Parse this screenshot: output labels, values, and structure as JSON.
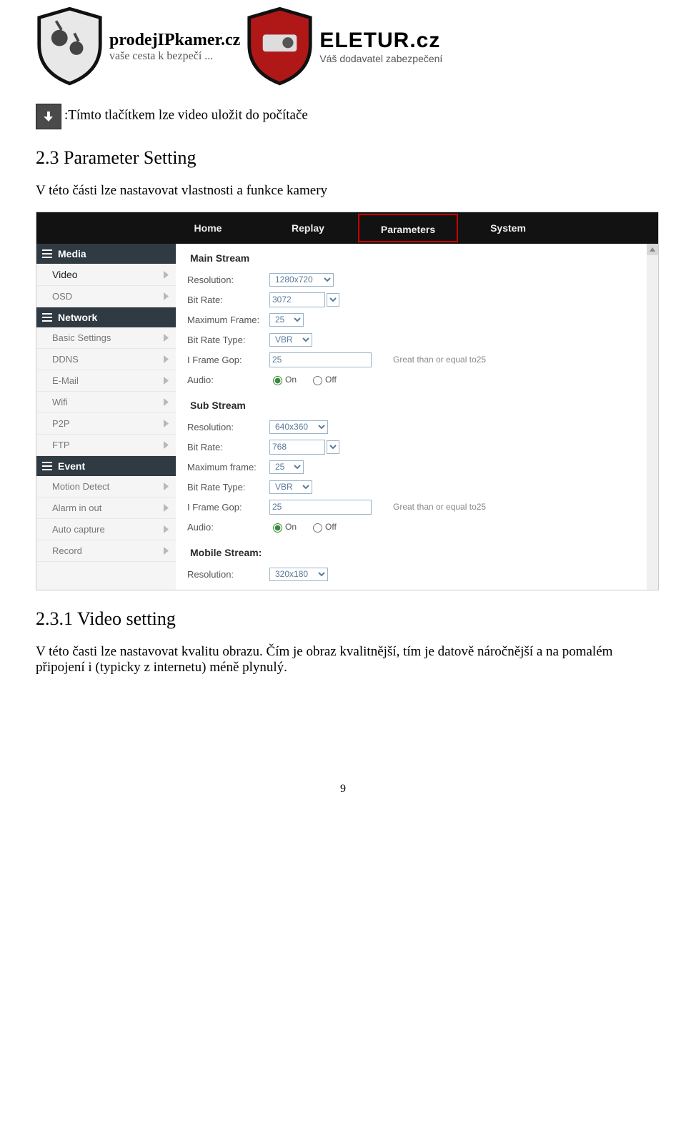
{
  "header": {
    "brand1": "prodejIPkamer.cz",
    "brand1_sub": "vaše cesta k bezpečí ...",
    "brand2": "ELETUR.cz",
    "brand2_sub": "Váš dodavatel zabezpečení"
  },
  "caption_dlbtn": ":Tímto tlačítkem lze video uložit do počítače",
  "sec23_title": "2.3 Parameter Setting",
  "sec23_text": "V této části lze nastavovat vlastnosti a funkce kamery",
  "tabs": {
    "home": "Home",
    "replay": "Replay",
    "parameters": "Parameters",
    "system": "System"
  },
  "sidebar": {
    "media_head": "Media",
    "video": "Video",
    "osd": "OSD",
    "network_head": "Network",
    "basic": "Basic Settings",
    "ddns": "DDNS",
    "email": "E-Mail",
    "wifi": "Wifi",
    "p2p": "P2P",
    "ftp": "FTP",
    "event_head": "Event",
    "motion": "Motion Detect",
    "alarm": "Alarm in out",
    "autocap": "Auto capture",
    "record": "Record"
  },
  "form": {
    "main_title": "Main Stream",
    "sub_title": "Sub Stream",
    "mobile_title": "Mobile Stream:",
    "l_resolution": "Resolution:",
    "l_bitrate": "Bit Rate:",
    "l_maxframe": "Maximum Frame:",
    "l_maxframe2": "Maximum frame:",
    "l_brtype": "Bit Rate Type:",
    "l_igop": "I Frame Gop:",
    "l_audio": "Audio:",
    "note": "Great than or equal to25",
    "on": "On",
    "off": "Off",
    "main": {
      "resolution": "1280x720",
      "bitrate": "3072",
      "maxframe": "25",
      "brtype": "VBR",
      "igop": "25"
    },
    "sub": {
      "resolution": "640x360",
      "bitrate": "768",
      "maxframe": "25",
      "brtype": "VBR",
      "igop": "25"
    },
    "mobile": {
      "resolution": "320x180"
    }
  },
  "sec231_title": "2.3.1 Video setting",
  "sec231_text": "V této časti lze nastavovat kvalitu obrazu. Čím je obraz kvalitnější, tím je datově náročnější a na pomalém připojení i (typicky z internetu) méně plynulý.",
  "pagenum": "9"
}
